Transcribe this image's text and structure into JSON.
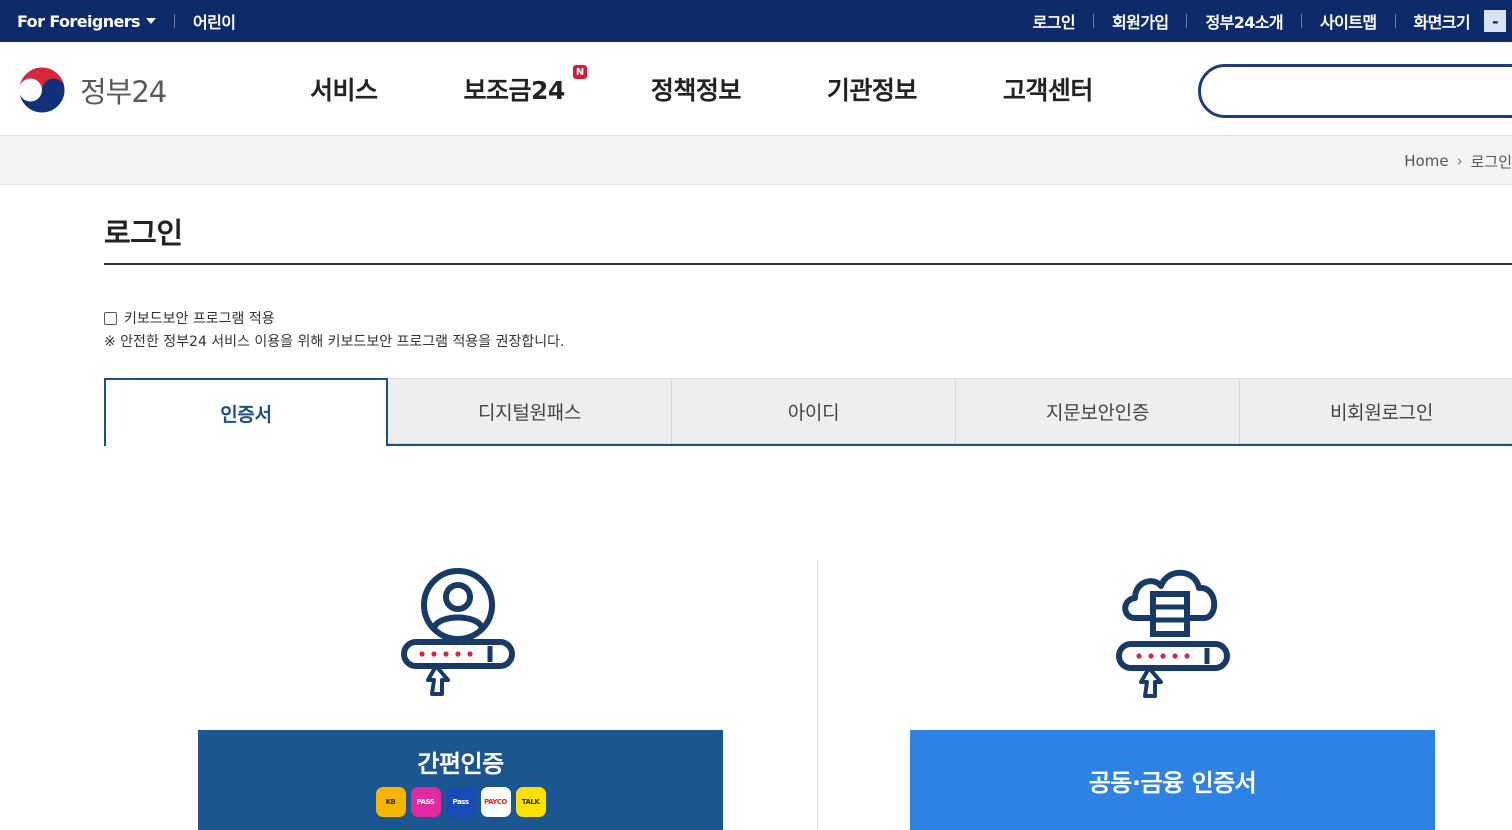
{
  "topbar": {
    "foreigners": "For Foreigners",
    "kids": "어린이",
    "links": [
      "로그인",
      "회원가입",
      "정부24소개",
      "사이트맵",
      "화면크기"
    ],
    "zoom_out": "-"
  },
  "header": {
    "logo_text": "정부24",
    "nav": [
      "서비스",
      "보조금24",
      "정책정보",
      "기관정보",
      "고객센터"
    ],
    "new_badge": "N",
    "search_placeholder": ""
  },
  "breadcrumb": {
    "home": "Home",
    "current": "로그인"
  },
  "page": {
    "title": "로그인",
    "keyboard_security_label": "키보드보안 프로그램 적용",
    "keyboard_security_note": "※ 안전한 정부24 서비스 이용을 위해 키보드보안 프로그램 적용을 권장합니다."
  },
  "tabs": [
    {
      "label": "인증서",
      "active": true
    },
    {
      "label": "디지털원패스",
      "active": false
    },
    {
      "label": "아이디",
      "active": false
    },
    {
      "label": "지문보안인증",
      "active": false
    },
    {
      "label": "비회원로그인",
      "active": false
    }
  ],
  "options": {
    "simple_auth": "간편인증",
    "joint_cert": "공동·금융 인증서",
    "providers": [
      {
        "name": "KB",
        "label": "KB",
        "color": "#f6b600"
      },
      {
        "name": "PASS",
        "label": "PASS",
        "color": "#e02aa0"
      },
      {
        "name": "Samsung Pass",
        "label": "Pass",
        "color": "#1a49b8"
      },
      {
        "name": "PAYCO",
        "label": "PAYCO",
        "color": "#ffffff"
      },
      {
        "name": "KakaoTalk",
        "label": "TALK",
        "color": "#fae100"
      }
    ]
  },
  "colors": {
    "topbar": "#0d2a6b",
    "primary": "#1b5690",
    "accent": "#2d82e3",
    "badge": "#d21e3c"
  }
}
